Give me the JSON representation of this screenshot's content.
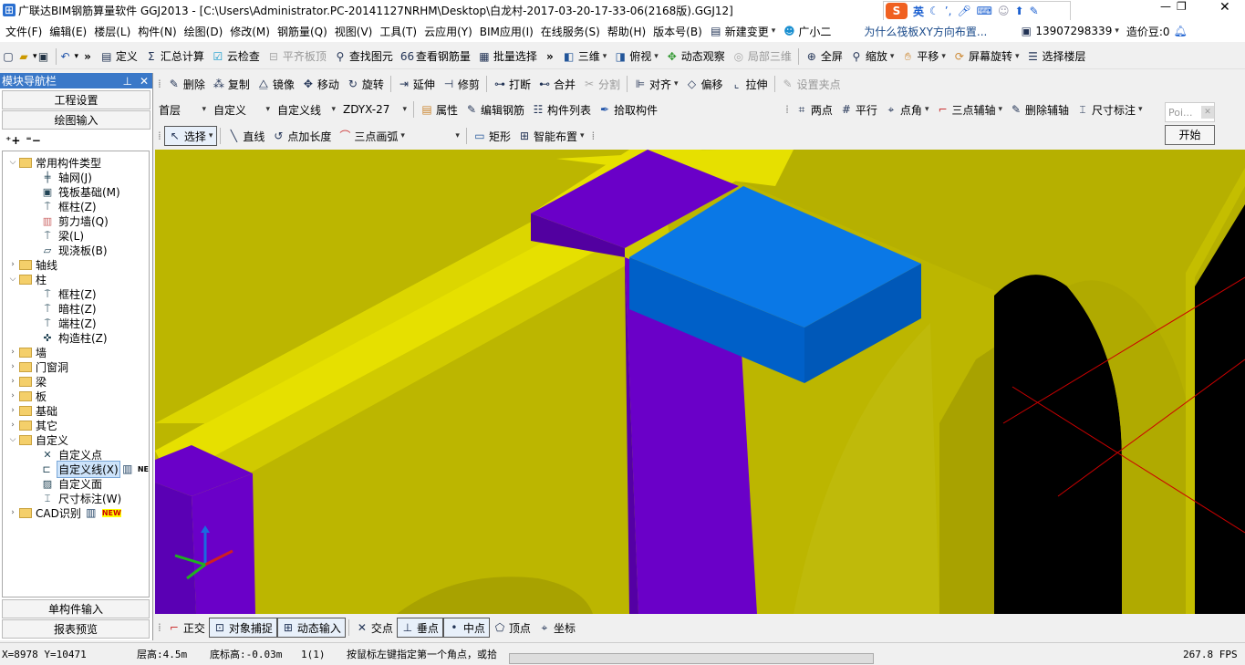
{
  "titlebar": {
    "title": "广联达BIM钢筋算量软件 GGJ2013 - [C:\\Users\\Administrator.PC-20141127NRHM\\Desktop\\白龙村-2017-03-20-17-33-06(2168版).GGJ12]",
    "ime_label": "英",
    "ime_logo": "S"
  },
  "menu": [
    "文件(F)",
    "编辑(E)",
    "楼层(L)",
    "构件(N)",
    "绘图(D)",
    "修改(M)",
    "钢筋量(Q)",
    "视图(V)",
    "工具(T)",
    "云应用(Y)",
    "BIM应用(I)",
    "在线服务(S)",
    "帮助(H)",
    "版本号(B)"
  ],
  "menu_right": {
    "new_change": "新建变更",
    "guangxiaoer": "广小二",
    "question": "为什么筏板XY方向布置...",
    "phone": "13907298339",
    "price_beans": "造价豆:0"
  },
  "toolbar1": [
    "定义",
    "汇总计算",
    "云检查",
    "平齐板顶",
    "查找图元",
    "查看钢筋量",
    "批量选择",
    "三维",
    "俯视",
    "动态观察",
    "局部三维",
    "全屏",
    "缩放",
    "平移",
    "屏幕旋转",
    "选择楼层"
  ],
  "toolbar2": [
    "删除",
    "复制",
    "镜像",
    "移动",
    "旋转",
    "延伸",
    "修剪",
    "打断",
    "合并",
    "分割",
    "对齐",
    "偏移",
    "拉伸",
    "设置夹点"
  ],
  "toolbar3": {
    "floor": "首层",
    "category": "自定义",
    "type": "自定义线",
    "component": "ZDYX-27",
    "buttons": [
      "属性",
      "编辑钢筋",
      "构件列表",
      "拾取构件"
    ],
    "axis_buttons": [
      "两点",
      "平行",
      "点角",
      "三点辅轴",
      "删除辅轴",
      "尺寸标注"
    ]
  },
  "toolbar4": [
    "选择",
    "直线",
    "点加长度",
    "三点画弧",
    "矩形",
    "智能布置"
  ],
  "float_panel": {
    "input_placeholder": "Poi...",
    "start": "开始"
  },
  "nav": {
    "title": "模块导航栏",
    "btn_engineering": "工程设置",
    "btn_drawing": "绘图输入",
    "btn_single": "单构件输入",
    "btn_report": "报表预览",
    "tree": [
      {
        "label": "常用构件类型",
        "level": 0,
        "type": "folder",
        "open": true
      },
      {
        "label": "轴网(J)",
        "level": 1,
        "icon": "grid-icon"
      },
      {
        "label": "筏板基础(M)",
        "level": 1,
        "icon": "raft-icon"
      },
      {
        "label": "框柱(Z)",
        "level": 1,
        "icon": "column-icon"
      },
      {
        "label": "剪力墙(Q)",
        "level": 1,
        "icon": "wall-icon"
      },
      {
        "label": "梁(L)",
        "level": 1,
        "icon": "beam-icon"
      },
      {
        "label": "现浇板(B)",
        "level": 1,
        "icon": "slab-icon"
      },
      {
        "label": "轴线",
        "level": 0,
        "type": "folder",
        "open": false
      },
      {
        "label": "柱",
        "level": 0,
        "type": "folder",
        "open": true
      },
      {
        "label": "框柱(Z)",
        "level": 1,
        "icon": "column-icon"
      },
      {
        "label": "暗柱(Z)",
        "level": 1,
        "icon": "column-icon"
      },
      {
        "label": "端柱(Z)",
        "level": 1,
        "icon": "column-icon"
      },
      {
        "label": "构造柱(Z)",
        "level": 1,
        "icon": "column-icon"
      },
      {
        "label": "墙",
        "level": 0,
        "type": "folder",
        "open": false
      },
      {
        "label": "门窗洞",
        "level": 0,
        "type": "folder",
        "open": false
      },
      {
        "label": "梁",
        "level": 0,
        "type": "folder",
        "open": false
      },
      {
        "label": "板",
        "level": 0,
        "type": "folder",
        "open": false
      },
      {
        "label": "基础",
        "level": 0,
        "type": "folder",
        "open": false
      },
      {
        "label": "其它",
        "level": 0,
        "type": "folder",
        "open": false
      },
      {
        "label": "自定义",
        "level": 0,
        "type": "folder",
        "open": true
      },
      {
        "label": "自定义点",
        "level": 1,
        "icon": "point-icon"
      },
      {
        "label": "自定义线(X)",
        "level": 1,
        "icon": "line-icon",
        "selected": true,
        "badge": "NE"
      },
      {
        "label": "自定义面",
        "level": 1,
        "icon": "face-icon"
      },
      {
        "label": "尺寸标注(W)",
        "level": 1,
        "icon": "dimension-icon"
      },
      {
        "label": "CAD识别",
        "level": 0,
        "type": "folder",
        "open": false,
        "badge": "NEW"
      }
    ]
  },
  "snapbar": [
    "正交",
    "对象捕捉",
    "动态输入",
    "交点",
    "垂点",
    "中点",
    "顶点",
    "坐标"
  ],
  "status": {
    "coords": "X=8978 Y=10471",
    "floor_height": "层高:4.5m",
    "bottom_height": "底标高:-0.03m",
    "count": "1(1)",
    "hint": "按鼠标左键指定第一个角点，或拾",
    "fps": "267.8 FPS"
  },
  "colors": {
    "column": "#6a00c8",
    "beam_yellow": "#e6e000",
    "slab_blue": "#0a78e6",
    "wall_olive": "#bcb600"
  }
}
